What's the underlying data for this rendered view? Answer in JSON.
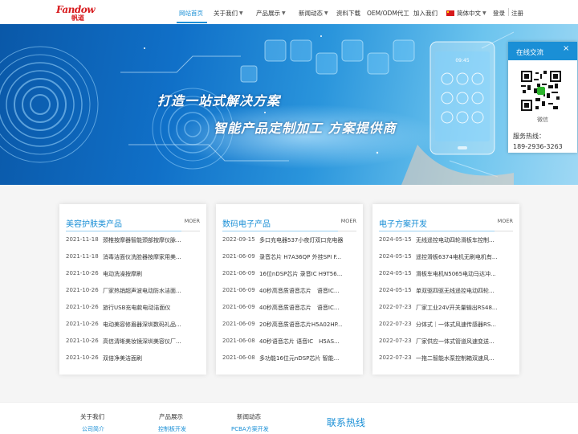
{
  "brand": {
    "logo_text": "Fandow",
    "logo_sub": "帆道"
  },
  "nav": {
    "items": [
      {
        "label": "网站首页",
        "dropdown": false,
        "active": true
      },
      {
        "label": "关于我们",
        "dropdown": true
      },
      {
        "label": "产品展示",
        "dropdown": true
      },
      {
        "label": "新闻动态",
        "dropdown": true
      },
      {
        "label": "资料下载",
        "dropdown": false
      },
      {
        "label": "OEM/ODM代工",
        "dropdown": false
      },
      {
        "label": "加入我们",
        "dropdown": false
      }
    ],
    "language": "简体中文",
    "login": "登录",
    "register": "注册"
  },
  "banner": {
    "line1": "打造一站式解决方案",
    "line2": "智能产品定制加工  方案提供商",
    "phone_time": "09:45"
  },
  "chat": {
    "title": "在线交流",
    "close": "×",
    "wechat_label": "微信",
    "hotline_label": "服务热线：",
    "hotline": "189-2936-3263"
  },
  "cards": [
    {
      "title": "美容护肤类产品",
      "more": "MOER",
      "items": [
        {
          "date": "2021-11-18",
          "title": "颈椎按摩器智能颈部按摩仪脉..."
        },
        {
          "date": "2021-11-18",
          "title": "消毒洁面仪洗脸器按摩家用美..."
        },
        {
          "date": "2021-10-26",
          "title": "电动洗澡按摩刷"
        },
        {
          "date": "2021-10-26",
          "title": "厂家热销超声波电动防水洁面..."
        },
        {
          "date": "2021-10-26",
          "title": "旅行USB充电款电动洁面仪"
        },
        {
          "date": "2021-10-26",
          "title": "电动美容修眉器深圳数码礼品..."
        },
        {
          "date": "2021-10-26",
          "title": "高信清晰美妆镜深圳美容仪厂..."
        },
        {
          "date": "2021-10-26",
          "title": "双倍净美洁面刷"
        }
      ]
    },
    {
      "title": "数码电子产品",
      "more": "MOER",
      "items": [
        {
          "date": "2022-09-15",
          "title": "多口充电器537小夜灯双口充电器"
        },
        {
          "date": "2021-06-09",
          "title": "录音芯片 H7A36QP 外挂SPI F..."
        },
        {
          "date": "2021-06-09",
          "title": "16位nDSP芯片 录音IC H9T56..."
        },
        {
          "date": "2021-06-09",
          "title": "40秒高音质语音芯片　语音IC..."
        },
        {
          "date": "2021-06-09",
          "title": "40秒高音质语音芯片　语音IC..."
        },
        {
          "date": "2021-06-09",
          "title": "20秒高音质语音芯片H5A02HP..."
        },
        {
          "date": "2021-06-08",
          "title": "40秒语音芯片 语音IC　H5AS..."
        },
        {
          "date": "2021-06-08",
          "title": "多功能16位元nDSP芯片 智能..."
        }
      ]
    },
    {
      "title": "电子方案开发",
      "more": "MOER",
      "items": [
        {
          "date": "2024-05-15",
          "title": "无线遥控电动四轮滑板车控制..."
        },
        {
          "date": "2024-05-15",
          "title": "遥控滑板6374电机无刷电机有..."
        },
        {
          "date": "2024-05-15",
          "title": "滑板车电机N5065电动马达冲..."
        },
        {
          "date": "2024-05-15",
          "title": "单双驱四驱无线遥控电动四轮..."
        },
        {
          "date": "2022-07-23",
          "title": "厂家工业24V开关量输出RS48..."
        },
        {
          "date": "2022-07-23",
          "title": "分体式｜一体式风速传感器RS..."
        },
        {
          "date": "2022-07-23",
          "title": "厂家供应一体式管道风速变送..."
        },
        {
          "date": "2022-07-23",
          "title": "一拖二智能水泵控制箱双速风..."
        }
      ]
    }
  ],
  "footer": {
    "columns": [
      {
        "title": "关于我们",
        "first": "公司简介"
      },
      {
        "title": "产品展示",
        "first": "控制板开发"
      },
      {
        "title": "新闻动态",
        "first": "PCBA方案开发"
      }
    ],
    "hotline_title": "联系热线"
  },
  "colors": {
    "accent": "#1a8fd6",
    "brand_red": "#d7191c"
  }
}
